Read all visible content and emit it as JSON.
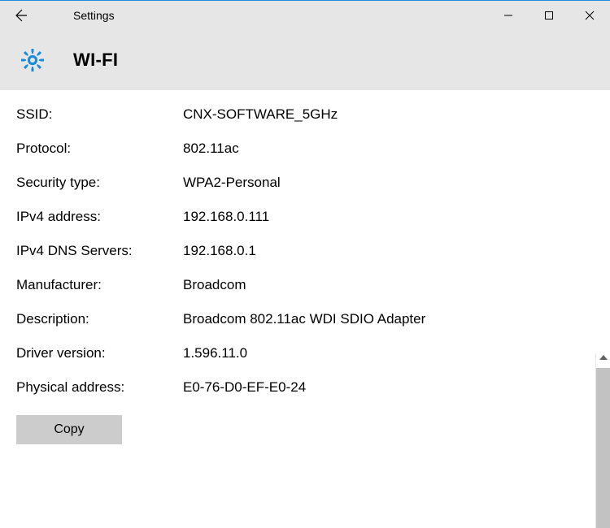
{
  "window": {
    "title": "Settings"
  },
  "page": {
    "heading": "WI-FI"
  },
  "properties": {
    "ssid": {
      "label": "SSID:",
      "value": "CNX-SOFTWARE_5GHz"
    },
    "protocol": {
      "label": "Protocol:",
      "value": "802.11ac"
    },
    "security_type": {
      "label": "Security type:",
      "value": "WPA2-Personal"
    },
    "ipv4_address": {
      "label": "IPv4 address:",
      "value": "192.168.0.111"
    },
    "ipv4_dns": {
      "label": "IPv4 DNS Servers:",
      "value": "192.168.0.1"
    },
    "manufacturer": {
      "label": "Manufacturer:",
      "value": "Broadcom"
    },
    "description": {
      "label": "Description:",
      "value": "Broadcom 802.11ac WDI SDIO Adapter"
    },
    "driver_version": {
      "label": "Driver version:",
      "value": "1.596.11.0"
    },
    "physical_address": {
      "label": "Physical address:",
      "value": "E0-76-D0-EF-E0-24"
    }
  },
  "buttons": {
    "copy": "Copy"
  },
  "colors": {
    "accent": "#1a8cd8",
    "header_bg": "#e6e6e6",
    "button_bg": "#cccccc"
  }
}
